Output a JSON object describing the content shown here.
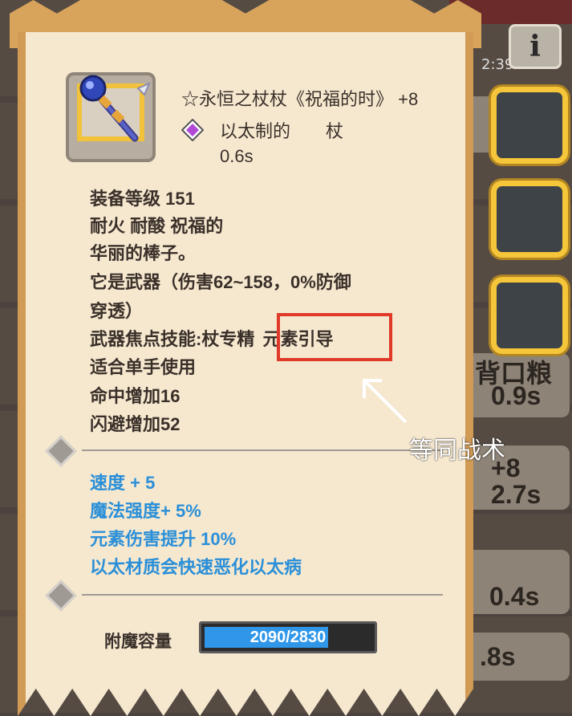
{
  "item": {
    "title": "☆永恒之杖杖《祝福的时》 +8",
    "material_type": "以太制的　　杖",
    "speed": "0.6s",
    "gear_level": "装备等级 151",
    "traits": "耐火 耐酸 祝福的",
    "description": "华丽的棒子。",
    "weapon_info_1": "它是武器（伤害62~158，0%防御",
    "weapon_info_2": "穿透）",
    "skill_prefix": "武器焦点技能:杖专精",
    "skill_name": "元素引导",
    "usage": "适合单手使用",
    "hit_bonus": "命中增加16",
    "dodge_bonus": "闪避增加52",
    "bonuses": [
      "速度 + 5",
      "魔法强度+ 5%",
      "元素伤害提升 10%",
      "以太材质会快速恶化以太病"
    ],
    "enchant_label": "附魔容量",
    "enchant_value": "2090/2830",
    "enchant_fraction": 0.7385
  },
  "annotation": {
    "text": "等同战术"
  },
  "background": {
    "top_timer": "2:39",
    "texts": [
      "+8",
      "2.7s",
      "0.9s",
      "0.4s",
      ".8s",
      "背口粮"
    ]
  },
  "colors": {
    "scroll_bg": "#f6e8cf",
    "scroll_border": "#d19a55",
    "bonus_text": "#2a8fd8",
    "highlight": "#e0392a",
    "slot_border": "#f5c53a",
    "enchant_fill": "#2f96e8"
  },
  "icons": {
    "item": "staff-icon",
    "gem": "purple-gem-icon",
    "info": "info-icon",
    "divider": "diamond-icon",
    "arrow": "arrow-icon"
  }
}
